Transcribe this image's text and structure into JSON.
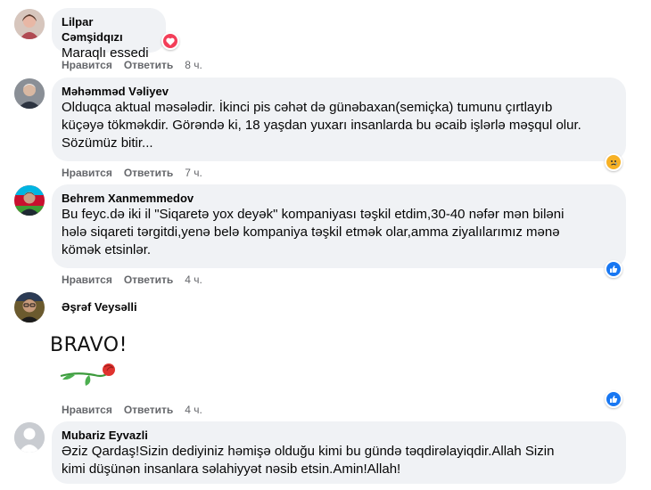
{
  "comments": [
    {
      "author": "Lilpar Cəmşidqızı",
      "text": "Maraqlı essedi",
      "like_label": "Нравится",
      "reply_label": "Ответить",
      "time": "8 ч.",
      "reaction": "love-icon",
      "avatar": "avatar-woman"
    },
    {
      "author": "Məhəmməd Vəliyev",
      "text": "Olduqca aktual məsələdir. İkinci pis cəhət də günəbaxan(semiçka) tumunu çırtlayıb\nküçəyə tökməkdir. Görəndə ki, 18 yaşdan yuxarı insanlarda bu əcaib işlərlə məşqul olur.\nSözümüz bitir...",
      "like_label": "Нравится",
      "reply_label": "Ответить",
      "time": "7 ч.",
      "reaction": "sad-icon",
      "avatar": "avatar-man-gray"
    },
    {
      "author": "Behrem Xanmemmedov",
      "text": "Bu feyc.də iki il \"Siqaretə yox deyək\" kompaniyası təşkil etdim,30-40 nəfər mən biləni\nhələ siqareti tərgitdi,yenə belə kompaniya təşkil etmək olar,amma ziyalılarımız mənə\nkömək etsinlər.",
      "like_label": "Нравится",
      "reply_label": "Ответить",
      "time": "4 ч.",
      "reaction": "like-icon",
      "avatar": "avatar-man-flag"
    },
    {
      "author": "Əşrəf Veysəlli",
      "sticker_text": "BRAVO!",
      "like_label": "Нравится",
      "reply_label": "Ответить",
      "time": "4 ч.",
      "reaction": "like-icon",
      "avatar": "avatar-man-glasses"
    },
    {
      "author": "Mubariz Eyvazli",
      "text": "Əziz Qardaş!Sizin dediyiniz həmişə olduğu kimi bu gündə təqdirəlayiqdir.Allah Sizin\nkimi düşünən insanlara səlahiyyət nəsib etsin.Amin!Allah!",
      "avatar": "avatar-default"
    }
  ],
  "colors": {
    "bubble": "#f0f2f5",
    "meta": "#65676b",
    "like_blue": "#1877f2",
    "love_red": "#f33e58",
    "sad_yellow": "#f7b125",
    "rose_red": "#e0332f"
  }
}
